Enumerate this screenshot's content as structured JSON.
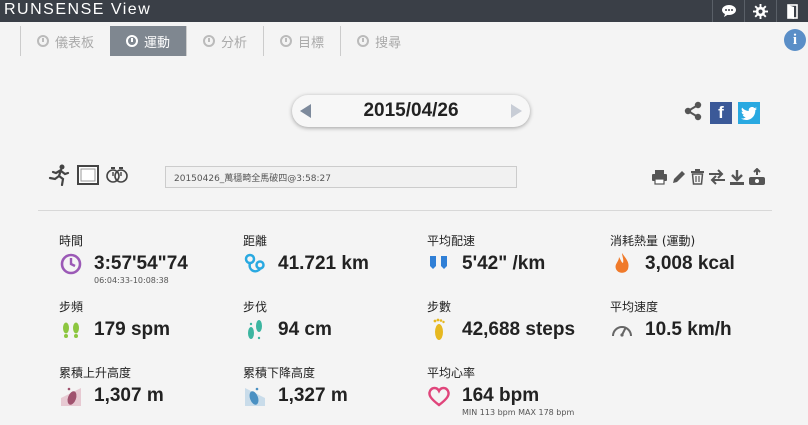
{
  "app": {
    "title": "RUNSENSE View"
  },
  "top_icons": [
    "chat-icon",
    "gear-icon",
    "exit-icon"
  ],
  "tabs": [
    {
      "label": "儀表板",
      "active": false
    },
    {
      "label": "運動",
      "active": true
    },
    {
      "label": "分析",
      "active": false
    },
    {
      "label": "目標",
      "active": false
    },
    {
      "label": "搜尋",
      "active": false
    }
  ],
  "date": "2015/04/26",
  "share": {
    "facebook_glyph": "f"
  },
  "workout": {
    "name": "20150426_萬穩畸全馬破四@3:58:27"
  },
  "metrics": {
    "time": {
      "label": "時間",
      "value": "3:57'54\"74",
      "sub": "06:04:33-10:08:38",
      "icon": "clock-icon",
      "color": "#9b59b6"
    },
    "distance": {
      "label": "距離",
      "value": "41.721 km",
      "icon": "route-icon",
      "color": "#29a9e1"
    },
    "pace": {
      "label": "平均配速",
      "value": "5'42\" /km",
      "icon": "pace-icon",
      "color": "#2f7fd6"
    },
    "calories": {
      "label": "消耗熱量 (運動)",
      "value": "3,008 kcal",
      "icon": "flame-icon",
      "color": "#f07a2a"
    },
    "cadence": {
      "label": "步頻",
      "value": "179 spm",
      "icon": "cadence-icon",
      "color": "#8cc63f"
    },
    "stride": {
      "label": "步伐",
      "value": "94 cm",
      "icon": "stride-icon",
      "color": "#3cb5a0"
    },
    "steps": {
      "label": "步數",
      "value": "42,688 steps",
      "icon": "footprint-icon",
      "color": "#e6b820"
    },
    "speed": {
      "label": "平均速度",
      "value": "10.5 km/h",
      "icon": "speedometer-icon",
      "color": "#666666"
    },
    "ascent": {
      "label": "累積上升高度",
      "value": "1,307 m",
      "icon": "ascent-icon",
      "color": "#a0526e"
    },
    "descent": {
      "label": "累積下降高度",
      "value": "1,327 m",
      "icon": "descent-icon",
      "color": "#4a90c2"
    },
    "heart_rate": {
      "label": "平均心率",
      "value": "164 bpm",
      "sub": "MIN 113 bpm MAX 178 bpm",
      "icon": "heart-icon",
      "color": "#e0457b"
    }
  }
}
